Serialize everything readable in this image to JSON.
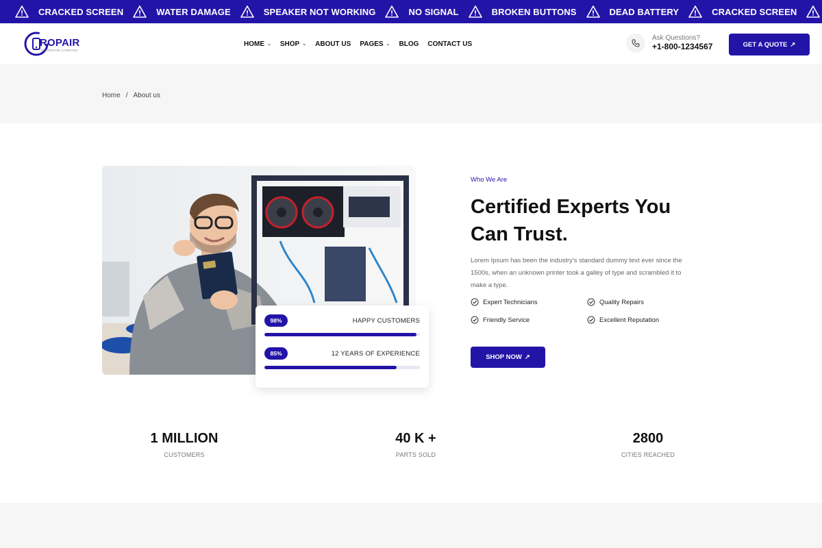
{
  "ticker": {
    "items": [
      "CRACKED SCREEN",
      "WATER DAMAGE",
      "SPEAKER NOT WORKING",
      "NO SIGNAL",
      "BROKEN BUTTONS",
      "DEAD BATTERY",
      "CRACKED SCREEN"
    ],
    "icon": "warning-triangle-icon"
  },
  "header": {
    "logo_text": "ROPAIR",
    "logo_sub": "MY REPAIR COMPANY",
    "nav": [
      {
        "label": "HOME",
        "dropdown": true
      },
      {
        "label": "SHOP",
        "dropdown": true
      },
      {
        "label": "ABOUT US",
        "dropdown": false
      },
      {
        "label": "PAGES",
        "dropdown": true
      },
      {
        "label": "BLOG",
        "dropdown": false
      },
      {
        "label": "CONTACT US",
        "dropdown": false
      }
    ],
    "ask_label": "Ask Questions?",
    "phone": "+1-800-1234567",
    "quote_button": "GET A QUOTE",
    "arrow": "↗"
  },
  "breadcrumb": {
    "home": "Home",
    "sep": "/",
    "current": "About us"
  },
  "about": {
    "eyebrow": "Who We Are",
    "title": "Certified Experts You Can Trust.",
    "description": "Lorem Ipsum has been the industry's standard dummy text ever since the 1500s, when an unknown printer took a galley of type and scrambled it to make a type.",
    "features": [
      "Expert Technicians",
      "Quality Repairs",
      "Friendly Service",
      "Excellent Reputation"
    ],
    "button": "SHOP NOW",
    "arrow": "↗",
    "bars": [
      {
        "pct_label": "98%",
        "value": 98,
        "label": "HAPPY CUSTOMERS"
      },
      {
        "pct_label": "85%",
        "value": 85,
        "label": "12 YEARS OF EXPERIENCE"
      }
    ]
  },
  "counters": [
    {
      "value": "1 MILLION",
      "label": "CUSTOMERS"
    },
    {
      "value": "40 K +",
      "label": "PARTS SOLD"
    },
    {
      "value": "2800",
      "label": "CITIES REACHED"
    }
  ],
  "colors": {
    "brand": "#2314a8",
    "band": "#f6f6f7"
  }
}
